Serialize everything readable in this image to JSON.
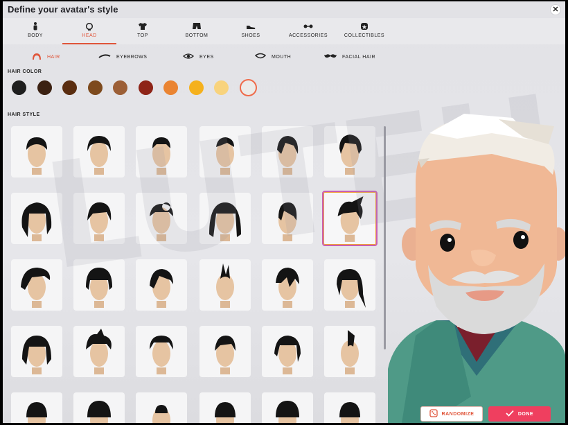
{
  "window": {
    "title": "Define your avatar's style",
    "close_label": "✕"
  },
  "tabs": [
    {
      "label": "BODY",
      "icon": "person-icon"
    },
    {
      "label": "HEAD",
      "icon": "head-icon",
      "active": true
    },
    {
      "label": "TOP",
      "icon": "shirt-icon"
    },
    {
      "label": "BOTTOM",
      "icon": "shorts-icon"
    },
    {
      "label": "SHOES",
      "icon": "shoe-icon"
    },
    {
      "label": "ACCESSORIES",
      "icon": "glasses-icon"
    },
    {
      "label": "COLLECTIBLES",
      "icon": "collectible-icon"
    }
  ],
  "subtabs": [
    {
      "label": "HAIR",
      "icon": "hair-icon",
      "active": true
    },
    {
      "label": "EYEBROWS",
      "icon": "eyebrow-icon"
    },
    {
      "label": "EYES",
      "icon": "eye-icon"
    },
    {
      "label": "MOUTH",
      "icon": "mouth-icon"
    },
    {
      "label": "FACIAL HAIR",
      "icon": "mustache-icon"
    }
  ],
  "hair_color": {
    "label": "HAIR COLOR",
    "swatches": [
      "#1e1e1e",
      "#3b2112",
      "#5a2d10",
      "#7d4a1d",
      "#9c5f36",
      "#8e2418",
      "#ea8432",
      "#f5b11d",
      "#f8d37d",
      "#ecebe8"
    ],
    "selected_index": 9
  },
  "hair_style": {
    "label": "HAIR STYLE",
    "selected_index": 11
  },
  "buttons": {
    "randomize": "RANDOMIZE",
    "done": "DONE"
  },
  "colors": {
    "accent": "#e0553a",
    "done": "#ef3f5f"
  },
  "watermark": "LUTEH"
}
